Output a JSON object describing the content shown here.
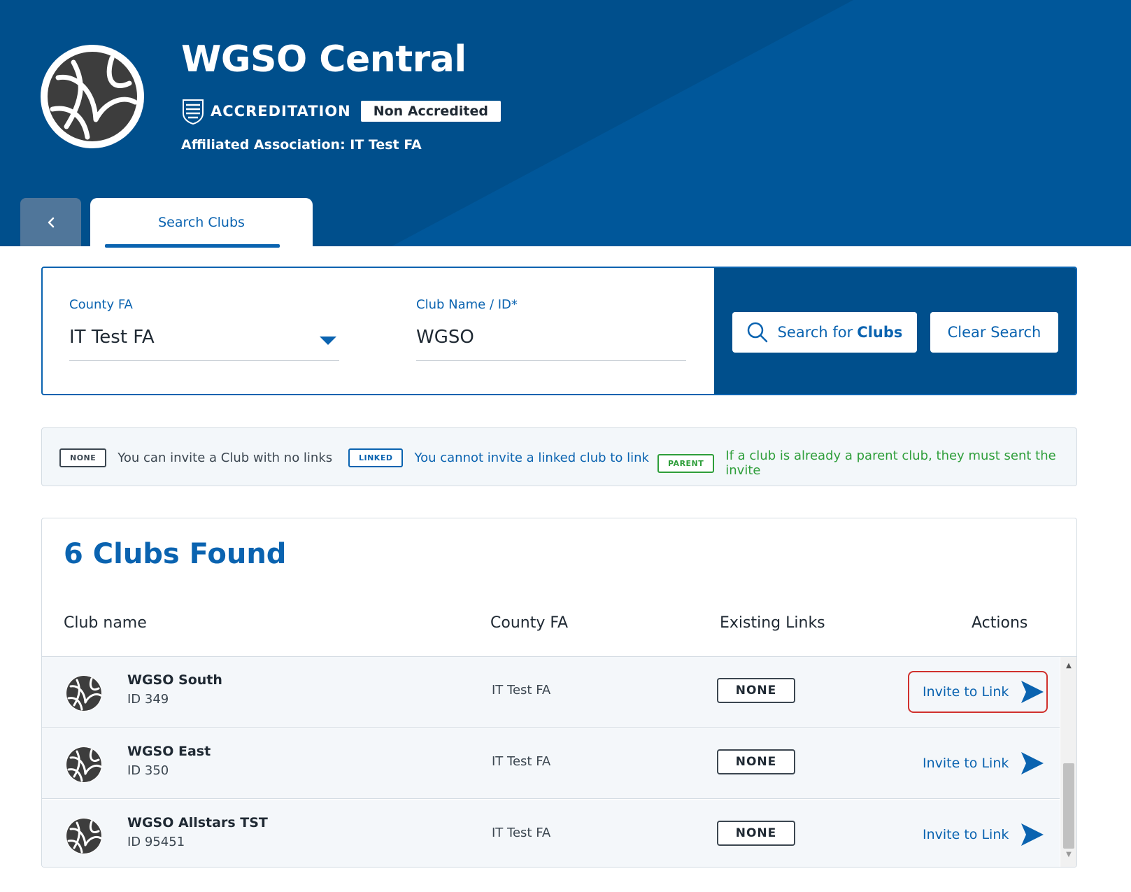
{
  "header": {
    "club_title": "WGSO Central",
    "accreditation_label": "ACCREDITATION",
    "accreditation_status": "Non Accredited",
    "affiliated": "Affiliated Association: IT Test FA"
  },
  "tabs": {
    "back_icon": "chevron-left-icon",
    "active_label": "Search Clubs"
  },
  "search": {
    "county_label": "County FA",
    "county_value": "IT Test FA",
    "club_label": "Club Name / ID*",
    "club_value": "WGSO",
    "search_button_prefix": "Search for",
    "search_button_bold": "Clubs",
    "clear_button": "Clear Search"
  },
  "legend": [
    {
      "chip": "NONE",
      "text": "You can invite a Club with no links",
      "color": "#3b4650"
    },
    {
      "chip": "LINKED",
      "text": "You cannot invite a linked club to link",
      "color": "#0a63b0"
    },
    {
      "chip": "PARENT",
      "text": "If a club is already a parent club, they must sent the invite",
      "color": "#2e9e3a"
    }
  ],
  "results": {
    "title": "6 Clubs Found",
    "columns": [
      "Club name",
      "County FA",
      "Existing Links",
      "Actions"
    ],
    "rows": [
      {
        "name": "WGSO South",
        "id": "ID 349",
        "county": "IT Test FA",
        "links": "NONE",
        "action": "Invite to Link"
      },
      {
        "name": "WGSO East",
        "id": "ID 350",
        "county": "IT Test FA",
        "links": "NONE",
        "action": "Invite to Link"
      },
      {
        "name": "WGSO Allstars TST",
        "id": "ID 95451",
        "county": "IT Test FA",
        "links": "NONE",
        "action": "Invite to Link"
      }
    ]
  },
  "colors": {
    "header_blue": "#004f8c",
    "accent_blue": "#0a63b0",
    "parent_green": "#2e9e3a",
    "focus_red": "#d0312d"
  }
}
